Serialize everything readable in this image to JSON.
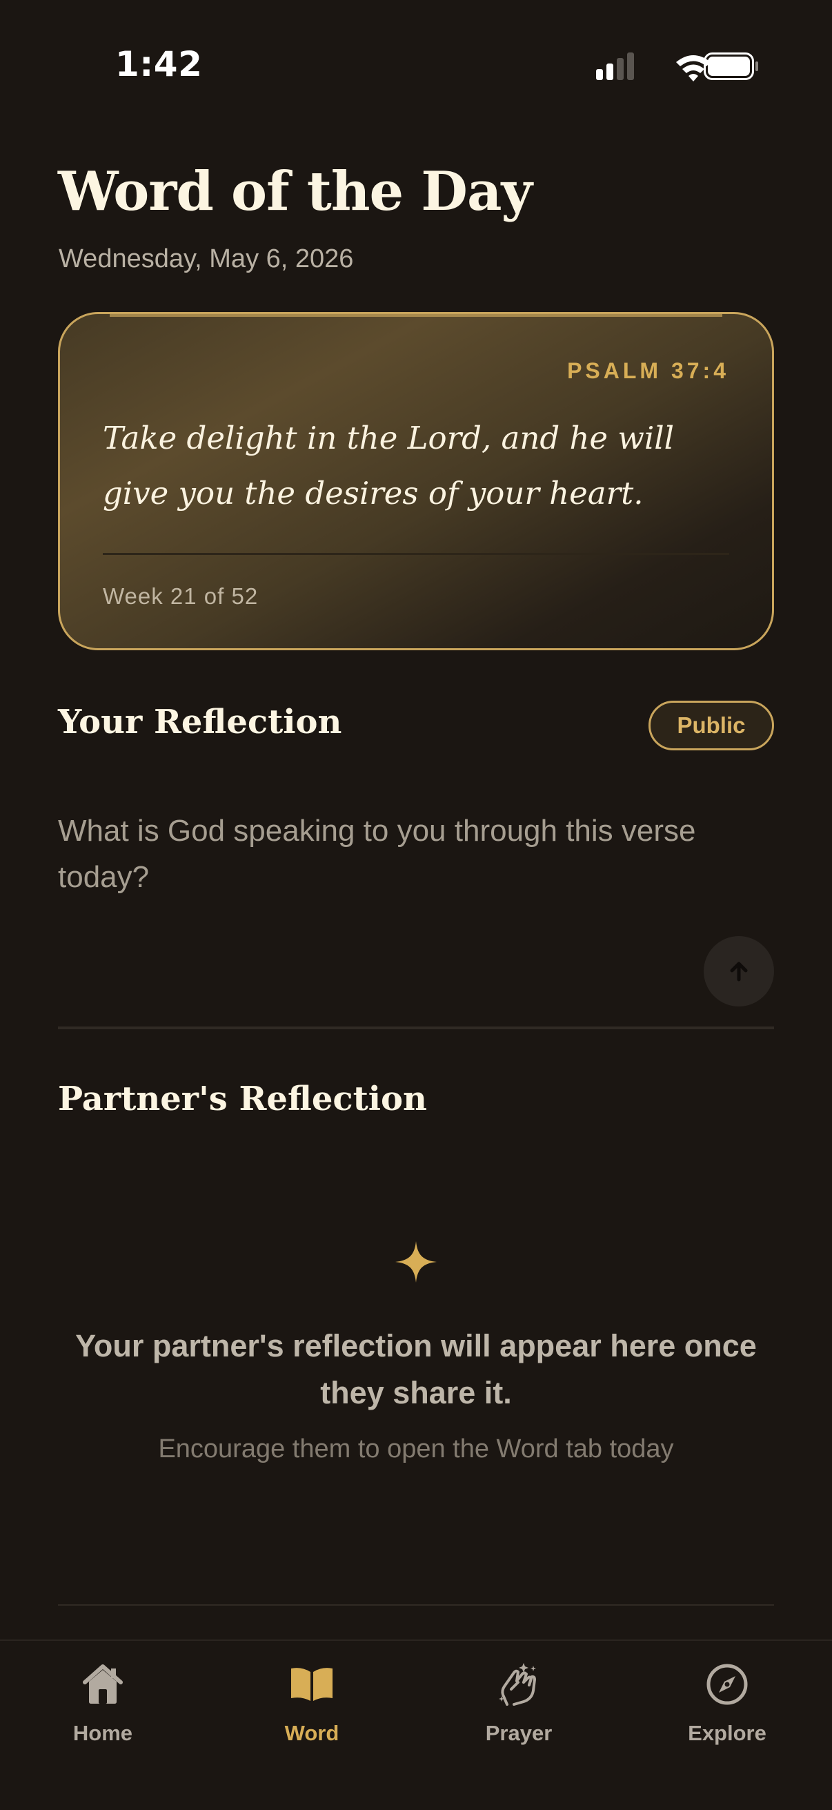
{
  "status_bar": {
    "time": "1:42"
  },
  "header": {
    "title": "Word of the Day",
    "date": "Wednesday, May 6, 2026"
  },
  "verse_card": {
    "reference": "PSALM 37:4",
    "text": "Take delight in the Lord, and he will give you the desires of your heart.",
    "week": "Week 21 of 52"
  },
  "your_reflection": {
    "title": "Your Reflection",
    "visibility": "Public",
    "placeholder": "What is God speaking to you through this verse today?",
    "value": ""
  },
  "partner_reflection": {
    "title": "Partner's Reflection",
    "empty_message": "Your partner's reflection will appear here once they share it.",
    "hint": "Encourage them to open the Word tab today"
  },
  "tabs": [
    {
      "label": "Home",
      "icon": "house-icon",
      "active": false
    },
    {
      "label": "Word",
      "icon": "open-book-icon",
      "active": true
    },
    {
      "label": "Prayer",
      "icon": "praying-hands-icon",
      "active": false
    },
    {
      "label": "Explore",
      "icon": "compass-icon",
      "active": false
    }
  ],
  "colors": {
    "background": "#1b1612",
    "accent_gold": "#d8ae56",
    "card_border": "#c9a55c",
    "text_primary": "#fcf5e2",
    "text_secondary": "#b9b1a4"
  }
}
